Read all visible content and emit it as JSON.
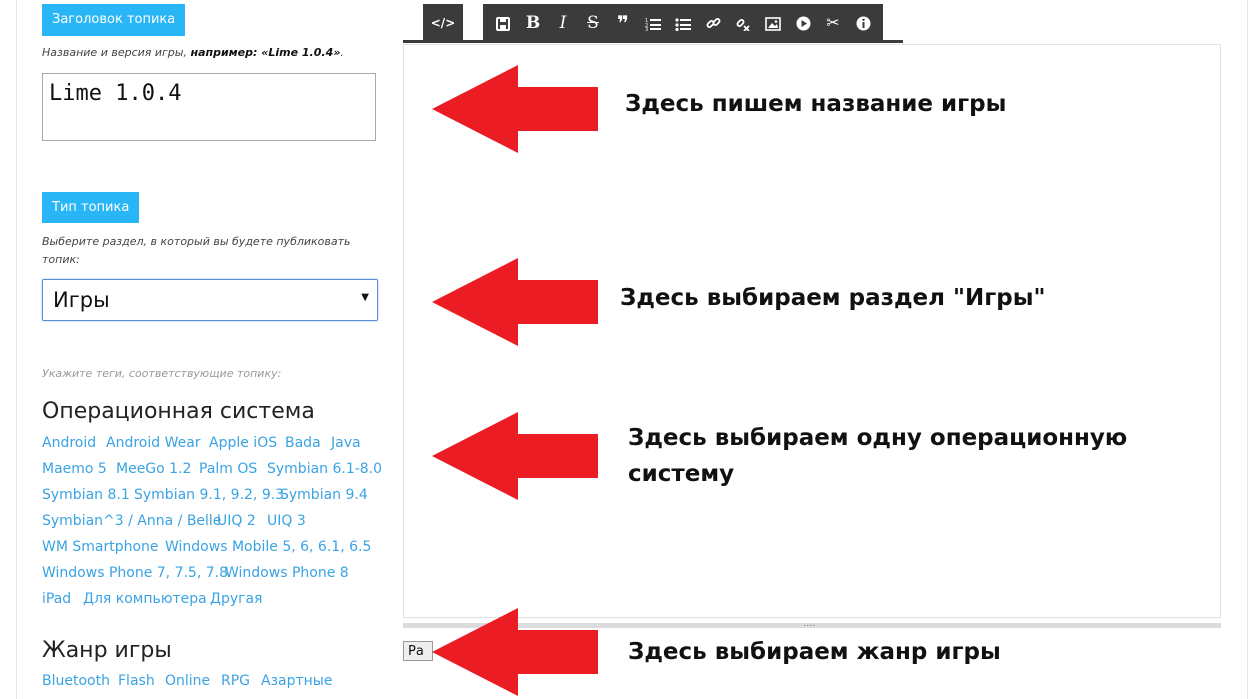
{
  "form": {
    "title_section_button": "Заголовок топика",
    "title_hint_prefix": "Название и версия игры, ",
    "title_hint_bold": "например: «Lime 1.0.4»",
    "title_hint_suffix": ".",
    "title_value": "Lime 1.0.4",
    "type_section_button": "Тип топика",
    "type_hint": "Выберите раздел, в который вы будете публиковать топик:",
    "type_selected": "Игры",
    "tags_hint": "Укажите теги, соответствующие топику:",
    "os_group_title": "Операционная система",
    "os_tags": [
      "Android",
      "Android Wear",
      "Apple iOS",
      "Bada",
      "Java",
      "Maemo 5",
      "MeeGo 1.2",
      "Palm OS",
      "Symbian 6.1-8.0",
      "Symbian 8.1",
      "Symbian 9.1, 9.2, 9.3",
      "Symbian 9.4",
      "Symbian^3 / Anna / Belle",
      "UIQ 2",
      "UIQ 3",
      "WM Smartphone",
      "Windows Mobile 5, 6, 6.1, 6.5",
      "Windows Phone 7, 7.5, 7.8",
      "Windows Phone 8",
      "iPad",
      "Для компьютера",
      "Другая"
    ],
    "genre_group_title": "Жанр игры",
    "genre_tags": [
      "Bluetooth",
      "Flash",
      "Online",
      "RPG",
      "Азартные"
    ],
    "submit_label": "Ра"
  },
  "editor": {
    "source_button": "</>",
    "toolbar_icons": [
      "save-icon",
      "bold-icon",
      "italic-icon",
      "strikethrough-icon",
      "quote-icon",
      "ordered-list-icon",
      "unordered-list-icon",
      "link-icon",
      "unlink-icon",
      "image-icon",
      "video-icon",
      "cut-icon",
      "info-icon"
    ]
  },
  "annotations": {
    "arrow_color": "#ec1c24",
    "title_note": "Здесь пишем название игры",
    "type_note": "Здесь выбираем раздел \"Игры\"",
    "os_note_line1": "Здесь выбираем одну операционную",
    "os_note_line2": "систему",
    "genre_note": "Здесь выбираем жанр игры"
  },
  "colors": {
    "accent": "#29b6f6",
    "tag_link": "#3aa3e3",
    "toolbar": "#3b3b3b"
  }
}
